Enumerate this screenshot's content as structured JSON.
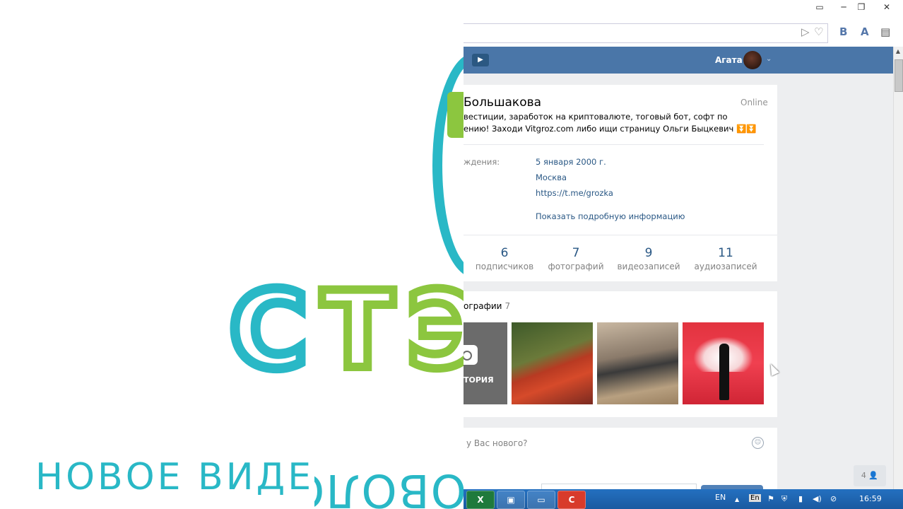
{
  "overlay": {
    "logo_letters": [
      "С",
      "Т",
      "Э"
    ],
    "banner_text": "НОВОЕ ВИДЕ",
    "mirrored_text": "ОВОЛО"
  },
  "browser": {
    "window_buttons": [
      "▭",
      "─",
      "❐",
      "✕"
    ],
    "address_icons": [
      "▷",
      "♡"
    ],
    "toolbar_icons": [
      "B",
      "A",
      "▤"
    ]
  },
  "vk": {
    "header": {
      "play_icon": "▶",
      "user_name": "Агата",
      "chevron": "⌄"
    },
    "profile": {
      "name": "Большакова",
      "online": "Online",
      "status_line1": "вестиции, заработок на криптовалюте, тоговый бот, софт по",
      "status_line2": "ению! Заходи Vitgroz.com либо ищи страницу Ольги Быцкевич ⏬⏬",
      "birth_label": "ждения:",
      "birth_value": "5 января 2000 г.",
      "city": "Москва",
      "link": "https://t.me/grozka",
      "more_info": "Показать подробную информацию"
    },
    "stats": [
      {
        "num": "6",
        "label": "подписчиков"
      },
      {
        "num": "7",
        "label": "фотографий"
      },
      {
        "num": "9",
        "label": "видеозаписей"
      },
      {
        "num": "11",
        "label": "аудиозаписей"
      }
    ],
    "photos": {
      "title": "ографии",
      "count": "7",
      "upload_label": "ТОРИЯ"
    },
    "post": {
      "placeholder": "у Вас нового?",
      "smile_icon": "☺"
    },
    "friends_badge": "4 👤"
  },
  "taskbar": {
    "apps": [
      "X",
      "▣",
      "▭",
      "C"
    ],
    "lang": "EN",
    "tray_icons": [
      "▲",
      "En",
      "⚑",
      "⛨",
      "▮",
      "◀)",
      "⊘"
    ],
    "clock": "16:59"
  }
}
